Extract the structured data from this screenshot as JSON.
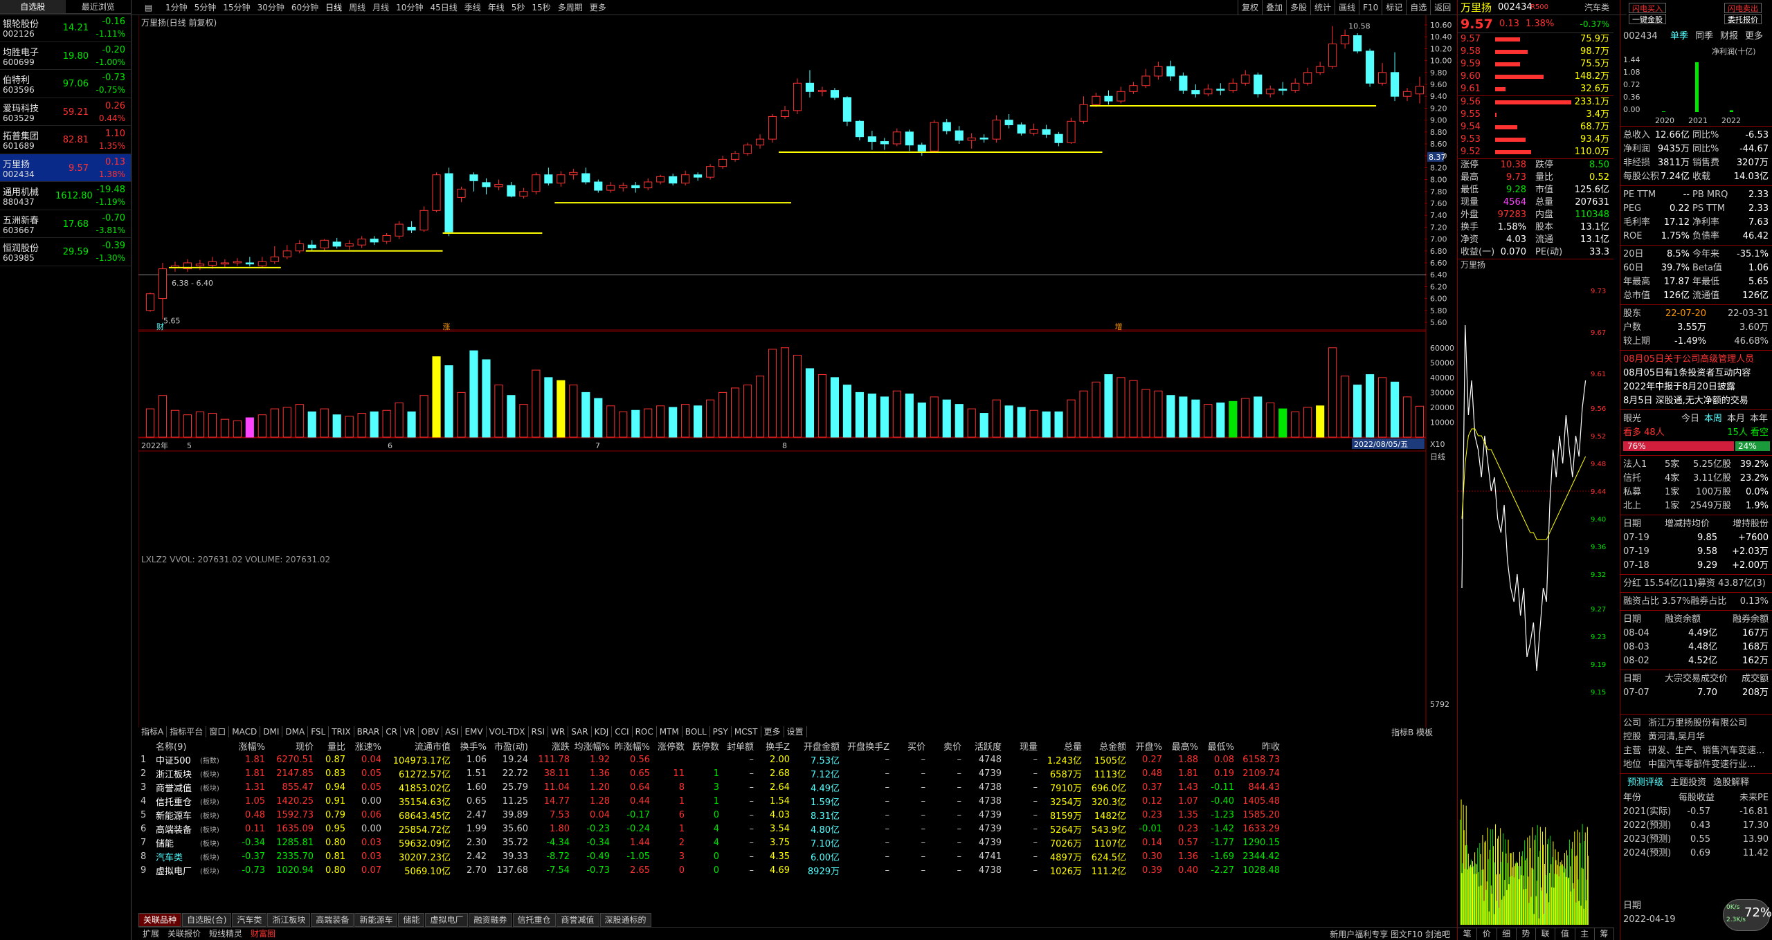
{
  "watchlist": {
    "tabs": [
      "自选股",
      "最近浏览"
    ],
    "items": [
      {
        "name": "银轮股份",
        "code": "002126",
        "price": "14.21",
        "chg": "-0.16",
        "pct": "-1.11%",
        "dir": "down"
      },
      {
        "name": "均胜电子",
        "code": "600699",
        "price": "19.80",
        "chg": "-0.20",
        "pct": "-1.00%",
        "dir": "down"
      },
      {
        "name": "伯特利",
        "code": "603596",
        "price": "97.06",
        "chg": "-0.73",
        "pct": "-0.75%",
        "dir": "down"
      },
      {
        "name": "爱玛科技",
        "code": "603529",
        "price": "59.21",
        "chg": "0.26",
        "pct": "0.44%",
        "dir": "up"
      },
      {
        "name": "拓普集团",
        "code": "601689",
        "price": "82.81",
        "chg": "1.10",
        "pct": "1.35%",
        "dir": "up"
      },
      {
        "name": "万里扬",
        "code": "002434",
        "price": "9.57",
        "chg": "0.13",
        "pct": "1.38%",
        "dir": "up",
        "selected": true
      },
      {
        "name": "通用机械",
        "code": "880437",
        "price": "1612.80",
        "chg": "-19.48",
        "pct": "-1.19%",
        "dir": "down"
      },
      {
        "name": "五洲新春",
        "code": "603667",
        "price": "17.68",
        "chg": "-0.70",
        "pct": "-3.81%",
        "dir": "down"
      },
      {
        "name": "恒润股份",
        "code": "603985",
        "price": "29.59",
        "chg": "-0.39",
        "pct": "-1.30%",
        "dir": "down"
      }
    ]
  },
  "toolbar": {
    "periods": [
      "1分钟",
      "5分钟",
      "15分钟",
      "30分钟",
      "60分钟",
      "日线",
      "周线",
      "月线",
      "10分钟",
      "45日线",
      "季线",
      "年线",
      "5秒",
      "15秒",
      "多周期",
      "更多"
    ],
    "active": "日线",
    "right": [
      "复权",
      "叠加",
      "多股",
      "统计",
      "画线",
      "F10",
      "标记",
      "自选",
      "返回"
    ]
  },
  "chart": {
    "title": "万里扬(日线 前复权)",
    "yticks": [
      "10.60",
      "10.40",
      "10.20",
      "10.00",
      "9.80",
      "9.60",
      "9.40",
      "9.20",
      "9.00",
      "8.80",
      "8.60",
      "8.40",
      "8.20",
      "8.00",
      "7.80",
      "7.60",
      "7.40",
      "7.20",
      "7.00",
      "6.80",
      "6.60",
      "6.40",
      "6.20",
      "6.00",
      "5.80",
      "5.60"
    ],
    "max_label": "10.58",
    "min_label": "5.65",
    "range_label": "6.38 - 6.40",
    "cursor_price": "8.37",
    "markers": [
      "财",
      "涨",
      "增"
    ],
    "vol_title": "LXLZ2 VVOL: 207631.02  VOLUME: 207631.02",
    "vol_yticks": [
      "60000",
      "50000",
      "40000",
      "30000",
      "20000",
      "10000"
    ],
    "dates": [
      "2022年",
      "5",
      "6",
      "7",
      "8"
    ],
    "date_end": "2022/08/05/五",
    "sub_label": "日线",
    "xlabel_5792": "5792",
    "x10": "X10"
  },
  "indicator_tabs": [
    "指标A",
    "指标平台",
    "窗口",
    "MACD",
    "DMI",
    "DMA",
    "FSL",
    "TRIX",
    "BRAR",
    "CR",
    "VR",
    "OBV",
    "ASI",
    "EMV",
    "VOL-TDX",
    "RSI",
    "WR",
    "SAR",
    "KDJ",
    "CCI",
    "ROC",
    "MTM",
    "BOLL",
    "PSY",
    "MCST",
    "更多",
    "设置"
  ],
  "ind_right": [
    "指标B",
    "模板"
  ],
  "table": {
    "headers": [
      "",
      "名称(9)",
      "",
      "涨幅%",
      "现价",
      "量比",
      "涨速%",
      "流通市值",
      "换手%",
      "市盈(动)",
      "涨跌",
      "均涨幅%",
      "昨涨幅%",
      "涨停数",
      "跌停数",
      "封单额",
      "换手Z",
      "开盘金额",
      "开盘换手Z",
      "买价",
      "卖价",
      "活跃度",
      "现量",
      "总量",
      "总金额",
      "开盘%",
      "最高%",
      "最低%",
      "昨收"
    ],
    "rows": [
      [
        "1",
        "中证500",
        "(指数)",
        "1.81",
        "6270.51",
        "0.87",
        "0.04",
        "104973.17亿",
        "1.06",
        "19.24",
        "111.78",
        "1.92",
        "0.56",
        "",
        "",
        "–",
        "2.00",
        "7.53亿",
        "–",
        "–",
        "–",
        "4748",
        "–",
        "1.243亿",
        "1505亿",
        "0.27",
        "1.88",
        "0.08",
        "6158.73"
      ],
      [
        "2",
        "浙江板块",
        "(板块)",
        "1.81",
        "2147.85",
        "0.83",
        "0.05",
        "61272.57亿",
        "1.51",
        "22.72",
        "38.11",
        "1.36",
        "0.65",
        "11",
        "1",
        "–",
        "2.68",
        "7.12亿",
        "–",
        "–",
        "–",
        "4739",
        "–",
        "6587万",
        "1113亿",
        "0.48",
        "1.81",
        "0.19",
        "2109.74"
      ],
      [
        "3",
        "商誉减值",
        "(板块)",
        "1.31",
        "855.47",
        "0.94",
        "0.05",
        "41853.02亿",
        "1.60",
        "25.79",
        "11.04",
        "1.20",
        "0.64",
        "8",
        "3",
        "–",
        "2.64",
        "4.49亿",
        "–",
        "–",
        "–",
        "4738",
        "–",
        "7910万",
        "696.0亿",
        "0.37",
        "1.43",
        "-0.11",
        "844.43"
      ],
      [
        "4",
        "信托重仓",
        "(板块)",
        "1.05",
        "1420.25",
        "0.91",
        "0.00",
        "35154.63亿",
        "0.65",
        "11.25",
        "14.77",
        "1.28",
        "0.44",
        "1",
        "1",
        "–",
        "1.54",
        "1.59亿",
        "–",
        "–",
        "–",
        "4738",
        "–",
        "3254万",
        "320.3亿",
        "0.12",
        "1.07",
        "-0.40",
        "1405.48"
      ],
      [
        "5",
        "新能源车",
        "(板块)",
        "0.48",
        "1592.73",
        "0.79",
        "0.06",
        "68643.45亿",
        "2.47",
        "39.89",
        "7.53",
        "0.04",
        "-0.17",
        "6",
        "0",
        "–",
        "4.03",
        "8.31亿",
        "–",
        "–",
        "–",
        "4739",
        "–",
        "8159万",
        "1482亿",
        "0.23",
        "1.35",
        "-1.23",
        "1585.20"
      ],
      [
        "6",
        "高端装备",
        "(板块)",
        "0.11",
        "1635.09",
        "0.95",
        "0.00",
        "25854.72亿",
        "1.99",
        "35.60",
        "1.80",
        "-0.23",
        "-0.24",
        "1",
        "4",
        "–",
        "3.54",
        "4.80亿",
        "–",
        "–",
        "–",
        "4739",
        "–",
        "5264万",
        "543.9亿",
        "-0.01",
        "0.23",
        "-1.42",
        "1633.29"
      ],
      [
        "7",
        "储能",
        "(板块)",
        "-0.34",
        "1285.81",
        "0.80",
        "0.03",
        "59632.09亿",
        "2.30",
        "35.72",
        "-4.34",
        "-0.34",
        "1.44",
        "2",
        "4",
        "–",
        "3.75",
        "7.10亿",
        "–",
        "–",
        "–",
        "4739",
        "–",
        "7026万",
        "1107亿",
        "0.14",
        "0.57",
        "-1.77",
        "1290.15"
      ],
      [
        "8",
        "汽车类",
        "(板块)",
        "-0.37",
        "2335.70",
        "0.81",
        "0.03",
        "30207.23亿",
        "2.42",
        "39.33",
        "-8.72",
        "-0.49",
        "-1.05",
        "3",
        "0",
        "–",
        "4.35",
        "6.00亿",
        "–",
        "–",
        "–",
        "4741",
        "–",
        "4897万",
        "624.5亿",
        "0.30",
        "1.36",
        "-1.69",
        "2344.42"
      ],
      [
        "9",
        "虚拟电厂",
        "(板块)",
        "-0.73",
        "1020.94",
        "0.80",
        "0.07",
        "5069.10亿",
        "2.70",
        "137.68",
        "-7.54",
        "-0.73",
        "2.65",
        "0",
        "0",
        "–",
        "4.69",
        "8929万",
        "–",
        "–",
        "–",
        "4738",
        "–",
        "1026万",
        "111.2亿",
        "0.39",
        "0.40",
        "-2.27",
        "1028.48"
      ]
    ]
  },
  "bottom_tabs": [
    "关联品种",
    "自选股(合)",
    "汽车类",
    "浙江板块",
    "高端装备",
    "新能源车",
    "储能",
    "虚拟电厂",
    "融资融券",
    "信托重仓",
    "商誉减值",
    "深股通标的"
  ],
  "status": {
    "left": [
      "扩展",
      "关联报价",
      "短线精灵",
      "财富圈"
    ],
    "right": "新用户福利专享 图文F10 剑池吧"
  },
  "quote": {
    "name": "万里扬",
    "code": "002434",
    "badge": "R500",
    "sector": "汽车类",
    "sector_pct": "-0.37%",
    "price": "9.57",
    "chg": "0.13",
    "pct": "1.38%",
    "asks": [
      [
        "9.61",
        "32.6万"
      ],
      [
        "9.60",
        "148.2万"
      ],
      [
        "9.59",
        "75.5万"
      ],
      [
        "9.58",
        "98.7万"
      ],
      [
        "9.57",
        "75.9万"
      ]
    ],
    "bids": [
      [
        "9.56",
        "233.1万"
      ],
      [
        "9.55",
        "3.4万"
      ],
      [
        "9.54",
        "68.7万"
      ],
      [
        "9.53",
        "93.4万"
      ],
      [
        "9.52",
        "110.0万"
      ]
    ],
    "stats": [
      [
        "涨停",
        "10.38",
        "跌停",
        "8.50"
      ],
      [
        "最高",
        "9.73",
        "量比",
        "0.52"
      ],
      [
        "最低",
        "9.28",
        "市值",
        "125.6亿"
      ],
      [
        "现量",
        "4564",
        "总量",
        "207631"
      ],
      [
        "外盘",
        "97283",
        "内盘",
        "110348"
      ],
      [
        "换手",
        "1.58%",
        "股本",
        "13.1亿"
      ],
      [
        "净资",
        "4.03",
        "流通",
        "13.1亿"
      ],
      [
        "收益(一)",
        "0.070",
        "PE(动)",
        "33.3"
      ]
    ],
    "mini_title": "万里扬",
    "mini_yticks": [
      "9.73",
      "9.67",
      "9.61",
      "9.56",
      "9.52",
      "9.48",
      "9.44",
      "9.40",
      "9.36",
      "9.32",
      "9.27",
      "9.23",
      "9.19",
      "9.15"
    ],
    "mini_bottom": [
      "笔",
      "价",
      "细",
      "势",
      "联",
      "值",
      "主",
      "筹"
    ]
  },
  "finance": {
    "top": [
      "闪电买入",
      "闪电卖出",
      "一键金股",
      "委托报价"
    ],
    "code": "002434",
    "tabs": [
      "单季",
      "同季",
      "财报",
      "更多"
    ],
    "profit_label": "净利润(十亿)",
    "bar_yticks": [
      "1.44",
      "1.08",
      "0.72",
      "0.36",
      "0.00"
    ],
    "bar_years": [
      "2020",
      "2021",
      "2022"
    ],
    "rows1": [
      [
        "总收入",
        "12.66亿",
        "同比%",
        "-6.53"
      ],
      [
        "净利润",
        "9435万",
        "同比%",
        "-44.67"
      ],
      [
        "非经损",
        "3811万",
        "销售费",
        "3207万"
      ],
      [
        "每股公积",
        "7.24亿",
        "收载",
        "14.03亿"
      ]
    ],
    "rows2": [
      [
        "PE TTM",
        "--",
        "PB MRQ",
        "2.33"
      ],
      [
        "PEG",
        "0.22",
        "PS TTM",
        "2.33"
      ],
      [
        "毛利率",
        "17.12",
        "净利率",
        "7.63"
      ],
      [
        "ROE",
        "1.75%",
        "负债率",
        "46.42"
      ]
    ],
    "rows3": [
      [
        "20日",
        "8.5%",
        "今年来",
        "-35.1%"
      ],
      [
        "60日",
        "39.7%",
        "Beta值",
        "1.06"
      ],
      [
        "年最高",
        "17.87",
        "年最低",
        "5.65"
      ],
      [
        "总市值",
        "126亿",
        "流通值",
        "126亿"
      ]
    ],
    "holders": [
      [
        "股东",
        "22-07-20",
        "22-03-31"
      ],
      [
        "户数",
        "3.55万",
        "3.60万"
      ],
      [
        "较上期",
        "-1.49%",
        "46.68%"
      ]
    ],
    "news": [
      "08月05日关于公司高级管理人员",
      "08月05日有1条投资者互动内容",
      "2022年中报于8月20日披露",
      "8月5日 深股通,无大净额的交易"
    ],
    "eye": {
      "label": "眼光",
      "tabs": [
        "今日",
        "本周",
        "本月",
        "本年"
      ],
      "left": "看多 48人",
      "right": "15人 看空",
      "pct_left": "76%",
      "pct_right": "24%"
    },
    "inst": [
      [
        "法人1",
        "5家",
        "5.25亿股",
        "39.2%"
      ],
      [
        "信托",
        "4家",
        "3.11亿股",
        "23.2%"
      ],
      [
        "私募",
        "1家",
        "100万股",
        "0.0%"
      ],
      [
        "北上",
        "1家",
        "2549万股",
        "1.9%"
      ]
    ],
    "holdings_head": [
      "日期",
      "增减持均价",
      "增持股份"
    ],
    "holdings": [
      [
        "07-19",
        "9.85",
        "+7600"
      ],
      [
        "07-19",
        "9.58",
        "+2.03万"
      ],
      [
        "07-18",
        "9.29",
        "+2.00万"
      ]
    ],
    "dividend": "分红 15.54亿(11)募资 43.87亿(3)",
    "margin": [
      "融资占比",
      "3.57%融券占比",
      "0.13%"
    ],
    "margin_head": [
      "日期",
      "融资余额",
      "融券余额"
    ],
    "margin_rows": [
      [
        "08-04",
        "4.49亿",
        "167万"
      ],
      [
        "08-03",
        "4.48亿",
        "168万"
      ],
      [
        "08-02",
        "4.52亿",
        "162万"
      ]
    ],
    "block_head": [
      "日期",
      "大宗交易成交价",
      "成交额"
    ],
    "block_rows": [
      [
        "07-07",
        "7.70",
        "208万"
      ]
    ],
    "company": [
      [
        "公司",
        "浙江万里扬股份有限公司"
      ],
      [
        "控股",
        "黄河清,吴月华"
      ],
      [
        "主营",
        "研发、生产、销售汽车变速..."
      ],
      [
        "地位",
        "中国汽车零部件变速行业..."
      ]
    ],
    "forecast_tabs": [
      "预测评级",
      "主题投资",
      "逸股解释"
    ],
    "forecast_head": [
      "年份",
      "每股收益",
      "未来PE"
    ],
    "forecast": [
      [
        "2021(实际)",
        "-0.57",
        "-16.81"
      ],
      [
        "2022(预测)",
        "0.43",
        "17.30"
      ],
      [
        "2023(预测)",
        "0.55",
        "13.90"
      ],
      [
        "2024(预测)",
        "0.69",
        "11.42"
      ]
    ],
    "last": [
      "日期",
      "2022-04-19"
    ],
    "speed": "72%",
    "speed_up": "0K/s",
    "speed_down": "2.3K/s"
  }
}
